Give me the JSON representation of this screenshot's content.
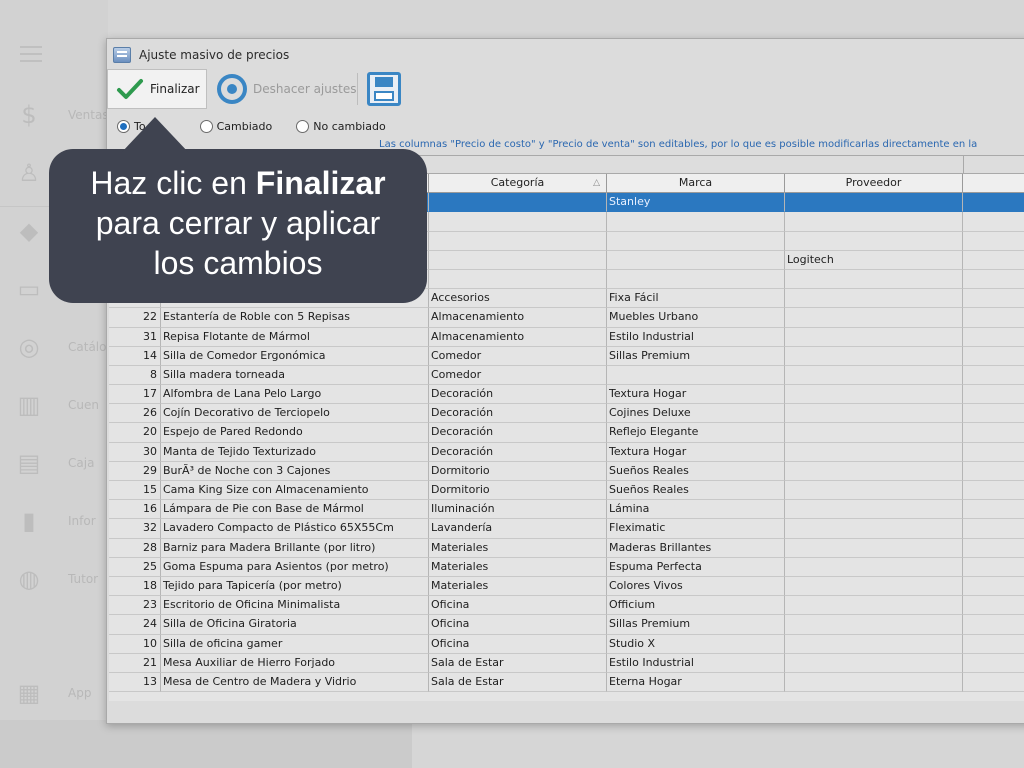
{
  "background_app": {
    "sidebar_items": [
      {
        "label": "Ventas",
        "icon": "dollar-icon"
      },
      {
        "label": "",
        "icon": "user-icon"
      },
      {
        "label": "",
        "icon": "tag-icon"
      },
      {
        "label": "",
        "icon": "calendar-icon"
      },
      {
        "label": "Catálo",
        "icon": "discount-icon"
      },
      {
        "label": "Cuen",
        "icon": "barcode-icon"
      },
      {
        "label": "Caja",
        "icon": "register-icon"
      },
      {
        "label": "Infor",
        "icon": "chart-bars-icon"
      },
      {
        "label": "Tutor",
        "icon": "lifebuoy-icon"
      },
      {
        "label": "App",
        "icon": "grid-icon"
      }
    ]
  },
  "dialog": {
    "title": "Ajuste masivo de precios",
    "toolbar": {
      "finalize_label": "Finalizar",
      "undo_label": "Deshacer ajustes"
    },
    "filters": [
      {
        "label": "To",
        "checked": true
      },
      {
        "label": "Cambiado",
        "checked": false
      },
      {
        "label": "No cambiado",
        "checked": false
      }
    ],
    "hint": "Las columnas \"Precio de costo\" y \"Precio de venta\" son editables, por lo que es posible modificarlas directamente en la",
    "columns": {
      "categoria": "Categoría",
      "marca": "Marca",
      "proveedor": "Proveedor"
    },
    "rows": [
      {
        "id": "",
        "name": "",
        "cat": "",
        "marca": "Stanley",
        "prov": "",
        "selected": true
      },
      {
        "id": "",
        "name": "",
        "cat": "",
        "marca": "",
        "prov": ""
      },
      {
        "id": "",
        "name": "",
        "cat": "",
        "marca": "",
        "prov": ""
      },
      {
        "id": "",
        "name": "",
        "cat": "",
        "marca": "",
        "prov": "Logitech"
      },
      {
        "id": "",
        "name": "",
        "cat": "",
        "marca": "",
        "prov": ""
      },
      {
        "id": "",
        "name": "",
        "cat": "Accesorios",
        "marca": "Fixa Fácil",
        "prov": ""
      },
      {
        "id": "22",
        "name": "Estantería de Roble con 5 Repisas",
        "cat": "Almacenamiento",
        "marca": "Muebles Urbano",
        "prov": ""
      },
      {
        "id": "31",
        "name": "Repisa Flotante de Mármol",
        "cat": "Almacenamiento",
        "marca": "Estilo Industrial",
        "prov": ""
      },
      {
        "id": "14",
        "name": "Silla de Comedor Ergonómica",
        "cat": "Comedor",
        "marca": "Sillas Premium",
        "prov": ""
      },
      {
        "id": "8",
        "name": "Silla madera torneada",
        "cat": "Comedor",
        "marca": "",
        "prov": ""
      },
      {
        "id": "17",
        "name": "Alfombra de Lana Pelo Largo",
        "cat": "Decoración",
        "marca": "Textura Hogar",
        "prov": ""
      },
      {
        "id": "26",
        "name": "Cojín Decorativo de Terciopelo",
        "cat": "Decoración",
        "marca": "Cojines Deluxe",
        "prov": ""
      },
      {
        "id": "20",
        "name": "Espejo de Pared Redondo",
        "cat": "Decoración",
        "marca": "Reflejo Elegante",
        "prov": ""
      },
      {
        "id": "30",
        "name": "Manta de Tejido Texturizado",
        "cat": "Decoración",
        "marca": "Textura Hogar",
        "prov": ""
      },
      {
        "id": "29",
        "name": "BurÃ³ de Noche con 3 Cajones",
        "cat": "Dormitorio",
        "marca": "Sueños Reales",
        "prov": ""
      },
      {
        "id": "15",
        "name": "Cama King Size con Almacenamiento",
        "cat": "Dormitorio",
        "marca": "Sueños Reales",
        "prov": ""
      },
      {
        "id": "16",
        "name": "Lámpara de Pie con Base de Mármol",
        "cat": "Iluminación",
        "marca": "Lámina",
        "prov": ""
      },
      {
        "id": "32",
        "name": "Lavadero Compacto de Plástico 65X55Cm",
        "cat": "Lavandería",
        "marca": "Fleximatic",
        "prov": ""
      },
      {
        "id": "28",
        "name": "Barniz para Madera Brillante (por litro)",
        "cat": "Materiales",
        "marca": "Maderas Brillantes",
        "prov": ""
      },
      {
        "id": "25",
        "name": "Goma Espuma para Asientos (por metro)",
        "cat": "Materiales",
        "marca": "Espuma Perfecta",
        "prov": ""
      },
      {
        "id": "18",
        "name": "Tejido para Tapicería (por metro)",
        "cat": "Materiales",
        "marca": "Colores Vivos",
        "prov": ""
      },
      {
        "id": "23",
        "name": "Escritorio de Oficina Minimalista",
        "cat": "Oficina",
        "marca": "Officium",
        "prov": ""
      },
      {
        "id": "24",
        "name": "Silla de Oficina Giratoria",
        "cat": "Oficina",
        "marca": "Sillas Premium",
        "prov": ""
      },
      {
        "id": "10",
        "name": "Silla de oficina gamer",
        "cat": "Oficina",
        "marca": "Studio X",
        "prov": ""
      },
      {
        "id": "21",
        "name": "Mesa Auxiliar de Hierro Forjado",
        "cat": "Sala de Estar",
        "marca": "Estilo Industrial",
        "prov": ""
      },
      {
        "id": "13",
        "name": "Mesa de Centro de Madera y Vidrio",
        "cat": "Sala de Estar",
        "marca": "Eterna Hogar",
        "prov": ""
      }
    ]
  },
  "tooltip": {
    "prefix": "Haz clic en ",
    "bold": "Finalizar",
    "line2": "para cerrar y aplicar",
    "line3": "los cambios"
  },
  "colors": {
    "tooltip_bg": "#3f4350",
    "selection": "#2b78c0",
    "accent_blue": "#3a86c4",
    "check_green": "#2e9a4e"
  }
}
